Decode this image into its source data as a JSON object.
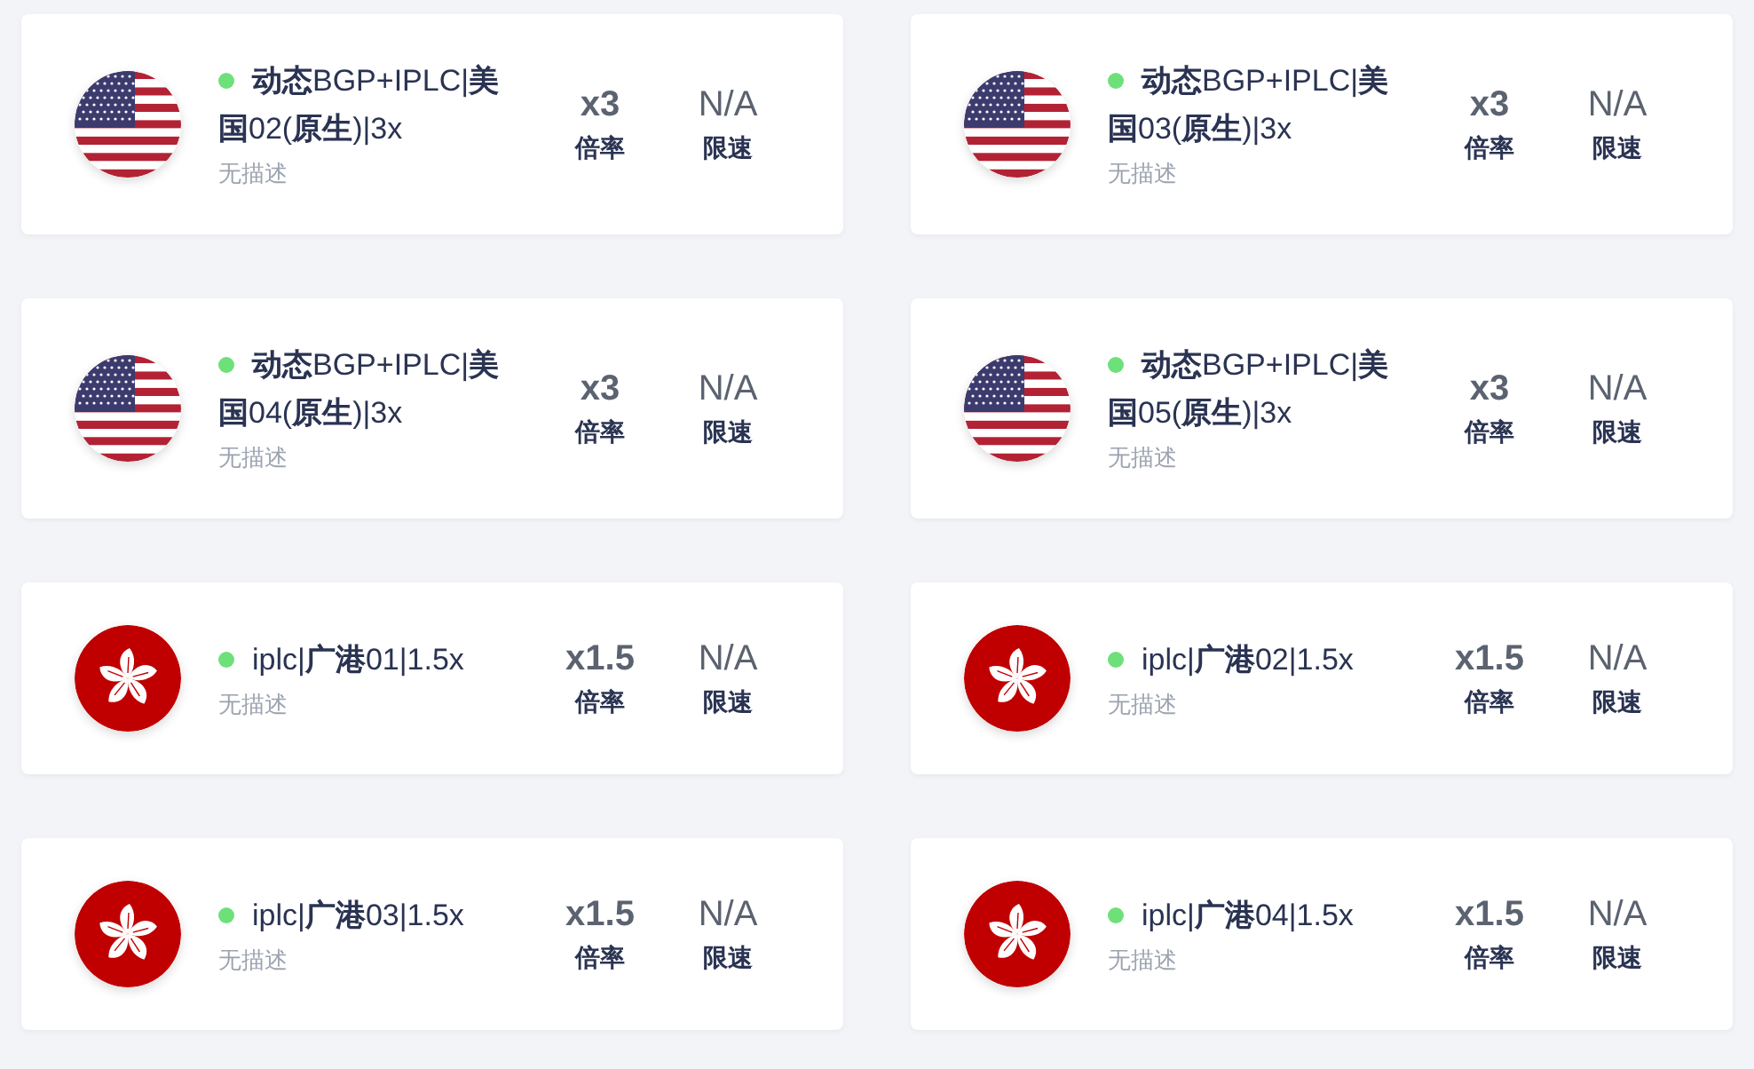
{
  "nodes": [
    {
      "kind": "us",
      "color": "#6ee07a",
      "name": "**动态**BGP+IPLC|**美国**02(**原生**)|3x",
      "description": "无描述",
      "rate": "x3",
      "rate_label": "倍率",
      "speed": "N/A",
      "speed_label": "限速"
    },
    {
      "kind": "us",
      "color": "#6ee07a",
      "name": "**动态**BGP+IPLC|**美国**03(**原生**)|3x",
      "description": "无描述",
      "rate": "x3",
      "rate_label": "倍率",
      "speed": "N/A",
      "speed_label": "限速"
    },
    {
      "kind": "us",
      "color": "#6ee07a",
      "name": "**动态**BGP+IPLC|**美国**04(**原生**)|3x",
      "description": "无描述",
      "rate": "x3",
      "rate_label": "倍率",
      "speed": "N/A",
      "speed_label": "限速"
    },
    {
      "kind": "us",
      "color": "#6ee07a",
      "name": "**动态**BGP+IPLC|**美国**05(**原生**)|3x",
      "description": "无描述",
      "rate": "x3",
      "rate_label": "倍率",
      "speed": "N/A",
      "speed_label": "限速"
    },
    {
      "kind": "hk",
      "color": "#6ee07a",
      "name": "iplc|**广港**01|1.5x",
      "description": "无描述",
      "rate": "x1.5",
      "rate_label": "倍率",
      "speed": "N/A",
      "speed_label": "限速"
    },
    {
      "kind": "hk",
      "color": "#6ee07a",
      "name": "iplc|**广港**02|1.5x",
      "description": "无描述",
      "rate": "x1.5",
      "rate_label": "倍率",
      "speed": "N/A",
      "speed_label": "限速"
    },
    {
      "kind": "hk",
      "color": "#6ee07a",
      "name": "iplc|**广港**03|1.5x",
      "description": "无描述",
      "rate": "x1.5",
      "rate_label": "倍率",
      "speed": "N/A",
      "speed_label": "限速"
    },
    {
      "kind": "hk",
      "color": "#6ee07a",
      "name": "iplc|**广港**04|1.5x",
      "description": "无描述",
      "rate": "x1.5",
      "rate_label": "倍率",
      "speed": "N/A",
      "speed_label": "限速"
    }
  ]
}
